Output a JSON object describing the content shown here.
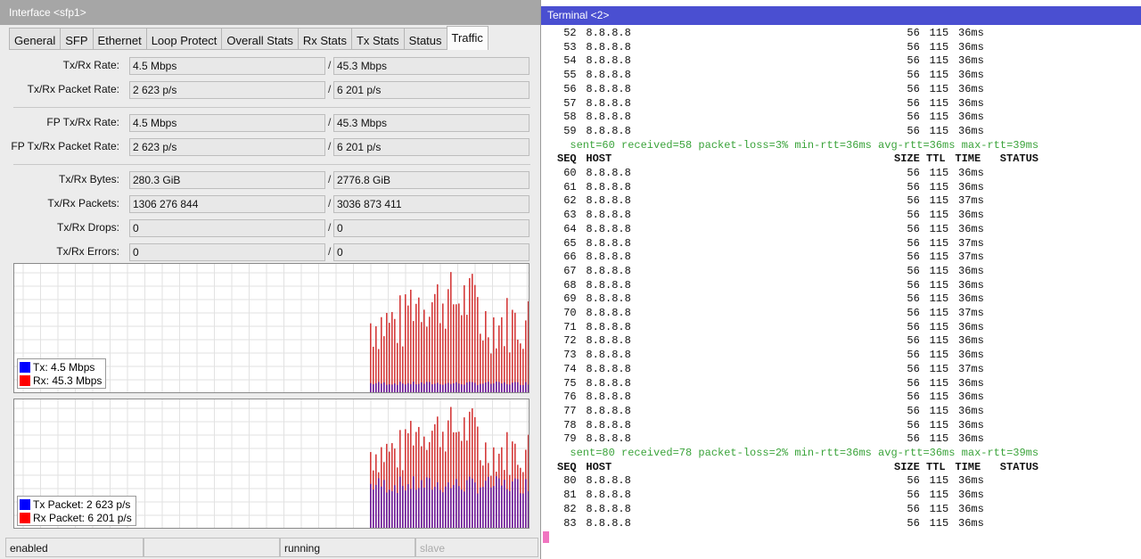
{
  "interface_window": {
    "title": "Interface <sfp1>",
    "tabs": [
      "General",
      "SFP",
      "Ethernet",
      "Loop Protect",
      "Overall Stats",
      "Rx Stats",
      "Tx Stats",
      "Status",
      "Traffic"
    ],
    "active_tab": "Traffic",
    "rows": [
      {
        "label": "Tx/Rx Rate:",
        "tx": "4.5 Mbps",
        "rx": "45.3 Mbps"
      },
      {
        "label": "Tx/Rx Packet Rate:",
        "tx": "2 623 p/s",
        "rx": "6 201 p/s"
      },
      {
        "label": "FP Tx/Rx Rate:",
        "tx": "4.5 Mbps",
        "rx": "45.3 Mbps"
      },
      {
        "label": "FP Tx/Rx Packet Rate:",
        "tx": "2 623 p/s",
        "rx": "6 201 p/s"
      },
      {
        "label": "Tx/Rx Bytes:",
        "tx": "280.3 GiB",
        "rx": "2776.8 GiB"
      },
      {
        "label": "Tx/Rx Packets:",
        "tx": "1306 276 844",
        "rx": "3036 873 411"
      },
      {
        "label": "Tx/Rx Drops:",
        "tx": "0",
        "rx": "0"
      },
      {
        "label": "Tx/Rx Errors:",
        "tx": "0",
        "rx": "0"
      }
    ],
    "separator": "/",
    "traffic_graph": {
      "legend": [
        {
          "label": "Tx:",
          "value": "4.5 Mbps",
          "color": "#0000ff"
        },
        {
          "label": "Rx:",
          "value": "45.3 Mbps",
          "color": "#ff0000"
        }
      ]
    },
    "packet_graph": {
      "legend": [
        {
          "label": "Tx Packet:",
          "value": "2 623 p/s",
          "color": "#0000ff"
        },
        {
          "label": "Rx Packet:",
          "value": "6 201 p/s",
          "color": "#ff0000"
        }
      ]
    },
    "statusbar": [
      "enabled",
      "",
      "running",
      "slave"
    ]
  },
  "terminal_window": {
    "title": "Terminal <2>",
    "host": "8.8.8.8",
    "size": "56",
    "ttl": "115",
    "header": {
      "seq": "SEQ",
      "host": "HOST",
      "size": "SIZE",
      "ttl": "TTL",
      "time": "TIME",
      "status": "STATUS"
    },
    "lines": [
      {
        "type": "ping",
        "seq": "52",
        "time": "36ms"
      },
      {
        "type": "ping",
        "seq": "53",
        "time": "36ms"
      },
      {
        "type": "ping",
        "seq": "54",
        "time": "36ms"
      },
      {
        "type": "ping",
        "seq": "55",
        "time": "36ms"
      },
      {
        "type": "ping",
        "seq": "56",
        "time": "36ms"
      },
      {
        "type": "ping",
        "seq": "57",
        "time": "36ms"
      },
      {
        "type": "ping",
        "seq": "58",
        "time": "36ms"
      },
      {
        "type": "ping",
        "seq": "59",
        "time": "36ms"
      },
      {
        "type": "summary",
        "text": "sent=60 received=58 packet-loss=3% min-rtt=36ms avg-rtt=36ms max-rtt=39ms"
      },
      {
        "type": "header"
      },
      {
        "type": "ping",
        "seq": "60",
        "time": "36ms"
      },
      {
        "type": "ping",
        "seq": "61",
        "time": "36ms"
      },
      {
        "type": "ping",
        "seq": "62",
        "time": "37ms"
      },
      {
        "type": "ping",
        "seq": "63",
        "time": "36ms"
      },
      {
        "type": "ping",
        "seq": "64",
        "time": "36ms"
      },
      {
        "type": "ping",
        "seq": "65",
        "time": "37ms"
      },
      {
        "type": "ping",
        "seq": "66",
        "time": "37ms"
      },
      {
        "type": "ping",
        "seq": "67",
        "time": "36ms"
      },
      {
        "type": "ping",
        "seq": "68",
        "time": "36ms"
      },
      {
        "type": "ping",
        "seq": "69",
        "time": "36ms"
      },
      {
        "type": "ping",
        "seq": "70",
        "time": "37ms"
      },
      {
        "type": "ping",
        "seq": "71",
        "time": "36ms"
      },
      {
        "type": "ping",
        "seq": "72",
        "time": "36ms"
      },
      {
        "type": "ping",
        "seq": "73",
        "time": "36ms"
      },
      {
        "type": "ping",
        "seq": "74",
        "time": "37ms"
      },
      {
        "type": "ping",
        "seq": "75",
        "time": "36ms"
      },
      {
        "type": "ping",
        "seq": "76",
        "time": "36ms"
      },
      {
        "type": "ping",
        "seq": "77",
        "time": "36ms"
      },
      {
        "type": "ping",
        "seq": "78",
        "time": "36ms"
      },
      {
        "type": "ping",
        "seq": "79",
        "time": "36ms"
      },
      {
        "type": "summary",
        "text": "sent=80 received=78 packet-loss=2% min-rtt=36ms avg-rtt=36ms max-rtt=39ms"
      },
      {
        "type": "header"
      },
      {
        "type": "ping",
        "seq": "80",
        "time": "36ms"
      },
      {
        "type": "ping",
        "seq": "81",
        "time": "36ms"
      },
      {
        "type": "ping",
        "seq": "82",
        "time": "36ms"
      },
      {
        "type": "ping",
        "seq": "83",
        "time": "36ms"
      }
    ]
  }
}
